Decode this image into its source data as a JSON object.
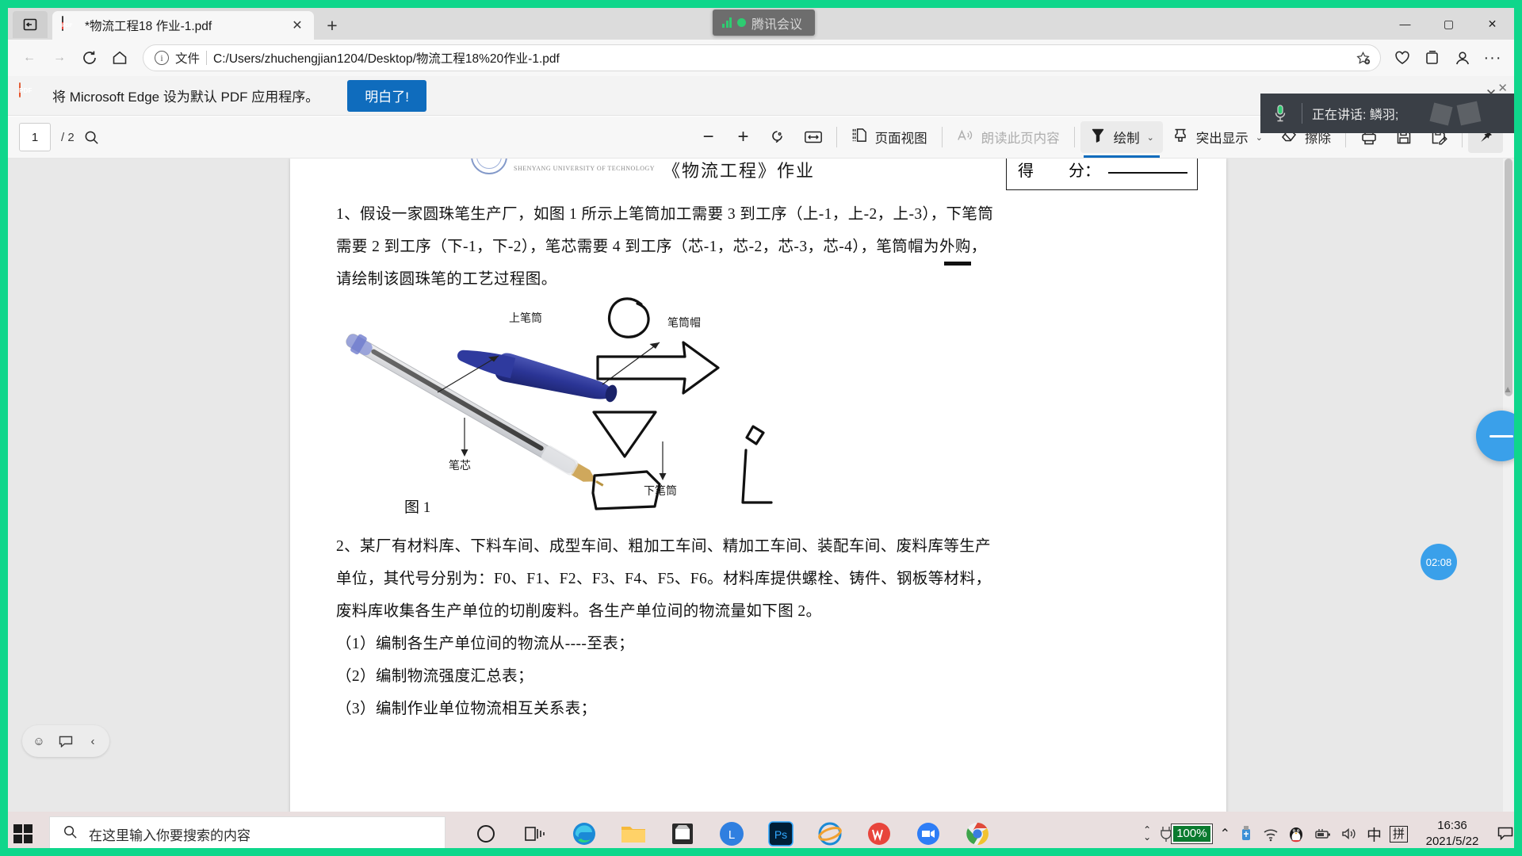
{
  "browser": {
    "tab": {
      "title": "*物流工程18 作业-1.pdf",
      "favicon_name": "pdf-file-icon",
      "close_label": "✕"
    },
    "new_tab_label": "+",
    "window_controls": {
      "minimize": "—",
      "maximize": "▢",
      "close": "✕"
    },
    "nav": {
      "back": "←",
      "forward": "→",
      "refresh": "⟳",
      "home": "⌂",
      "scheme_label": "文件",
      "url": "C:/Users/zhuchengjian1204/Desktop/物流工程18%20作业-1.pdf",
      "favorite_add": "☆",
      "favorites": "♡",
      "collections": "▤",
      "profile": "👤",
      "settings_more": "···"
    }
  },
  "notification": {
    "icon_name": "pdf-file-icon",
    "message": "将 Microsoft Edge 设为默认 PDF 应用程序。",
    "primary_button": "明白了!",
    "close": "✕"
  },
  "pdf_toolbar": {
    "page_current": "1",
    "page_total": "/ 2",
    "search": "search-icon",
    "zoom_out": "−",
    "zoom_in": "+",
    "rotate": "rotate-icon",
    "fit": "fit-to-width-icon",
    "page_view_icon": "page-view-icon",
    "page_view_label": "页面视图",
    "read_aloud_icon": "read-aloud-icon",
    "read_aloud_label": "朗读此页内容",
    "draw_icon": "pen-icon",
    "draw_label": "绘制",
    "draw_chevron": "⌄",
    "highlight_icon": "highlighter-icon",
    "highlight_label": "突出显示",
    "highlight_chevron": "⌄",
    "erase_icon": "eraser-icon",
    "erase_label": "擦除",
    "print": "printer-icon",
    "save": "save-icon",
    "save_as": "save-as-icon",
    "pin": "pin-icon"
  },
  "tencent_meeting": {
    "pill_label": "腾讯会议",
    "speaking_label": "正在讲话: 鳞羽;",
    "mic_icon": "microphone-icon",
    "timer": "02:08"
  },
  "document": {
    "header": {
      "seal_text": "SHENYANG  UNIVERSITY  OF  TECHNOLOGY",
      "title": "《物流工程》作业",
      "score_label_1": "得",
      "score_label_2": "分："
    },
    "question1": {
      "line1": "1、假设一家圆珠笔生产厂，如图 1 所示上笔筒加工需要 3 到工序（上-1，上-2，上-3），下笔筒",
      "line2": "需要 2 到工序（下-1，下-2），笔芯需要 4 到工序（芯-1，芯-2，芯-3，芯-4），笔筒帽为外购，",
      "line3": "请绘制该圆珠笔的工艺过程图。"
    },
    "figure1": {
      "caption": "图 1",
      "label_top_barrel": "上笔筒",
      "label_refill": "笔芯",
      "label_bottom_barrel": "下笔筒",
      "label_cap": "笔筒帽"
    },
    "question2": {
      "line1": "2、某厂有材料库、下料车间、成型车间、粗加工车间、精加工车间、装配车间、废料库等生产",
      "line2": "单位，其代号分别为：F0、F1、F2、F3、F4、F5、F6。材料库提供螺栓、铸件、钢板等材料，",
      "line3": "废料库收集各生产单位的切削废料。各生产单位间的物流量如下图 2。",
      "item1": "（1）编制各生产单位间的物流从----至表；",
      "item2": "（2）编制物流强度汇总表；",
      "item3": "（3）编制作业单位物流相互关系表；"
    }
  },
  "edge_widget": {
    "smiley": "☺",
    "feedback": "💬",
    "collapse": "‹"
  },
  "taskbar": {
    "start": "windows-logo",
    "search_placeholder": "在这里输入你要搜索的内容",
    "search_icon": "search-icon",
    "cortana": "cortana-icon",
    "task_view": "task-view-icon",
    "apps": [
      {
        "name": "microsoft-edge",
        "label": "Microsoft Edge"
      },
      {
        "name": "file-explorer",
        "label": "文件资源管理器"
      },
      {
        "name": "microsoft-store",
        "label": "Microsoft Store"
      },
      {
        "name": "lanxin-app",
        "label": "L"
      },
      {
        "name": "photoshop",
        "label": "Ps"
      },
      {
        "name": "internet-explorer",
        "label": "Internet Explorer"
      },
      {
        "name": "wps-office",
        "label": "WPS"
      },
      {
        "name": "tencent-meeting",
        "label": "腾讯会议"
      },
      {
        "name": "chrome-like-app",
        "label": "应用"
      }
    ],
    "tray": {
      "expand": "⌃",
      "battery_percent": "100%",
      "usb": "usb-icon",
      "network": "wifi-icon",
      "qq": "qq-penguin-icon",
      "battery_small": "battery-icon",
      "volume": "volume-icon",
      "ime_mode": "中",
      "ime_pinyin": "拼",
      "time": "16:36",
      "date": "2021/5/22",
      "action_center": "notification-icon"
    }
  },
  "colors": {
    "share_border": "#0fd68b",
    "accent_blue": "#0f6cbd",
    "meeting_blue": "#3aa0ea",
    "battery_green": "#0a7a2f",
    "taskbar_bg": "#e9dfdf"
  }
}
